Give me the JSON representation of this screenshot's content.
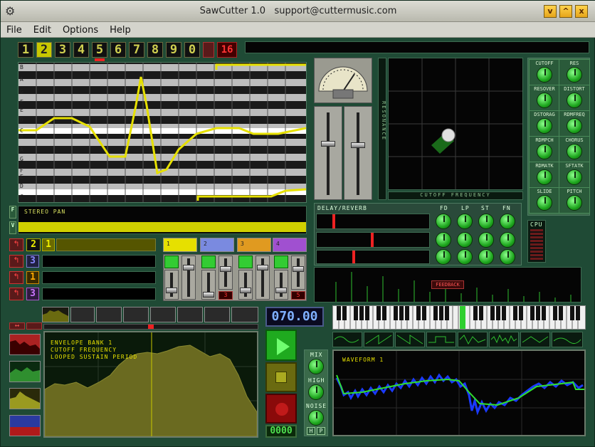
{
  "window": {
    "title": "SawCutter 1.0",
    "email": "support@cuttermusic.com"
  },
  "menu": [
    "File",
    "Edit",
    "Options",
    "Help"
  ],
  "patterns": {
    "numbers": [
      "1",
      "2",
      "3",
      "4",
      "5",
      "6",
      "7",
      "8",
      "9",
      "0"
    ],
    "selected": "2",
    "tempo_mult": "16"
  },
  "note_labels": [
    "B",
    "A",
    "G",
    "F",
    "E",
    "D",
    "C",
    "B",
    "A",
    "G",
    "F",
    "E",
    "D",
    "C"
  ],
  "rows": {
    "f": "F",
    "v": "V",
    "stereo_pan": "STEREO PAN"
  },
  "track_rows": [
    {
      "a": "2",
      "b": "1"
    },
    {
      "a": "3"
    },
    {
      "a": "1"
    },
    {
      "a": "3"
    }
  ],
  "channels": [
    {
      "label": "1",
      "color": "#e6e000",
      "mark": ""
    },
    {
      "label": "2",
      "color": "#7a8ae0",
      "mark": "3"
    },
    {
      "label": "3",
      "color": "#e09a20",
      "mark": ""
    },
    {
      "label": "4",
      "color": "#a050d0",
      "mark": "5"
    }
  ],
  "xy_pad": {
    "y_label": "RESONANCE",
    "x_label": "CUTOFF FREQUENCY"
  },
  "right_knobs": [
    "CUTOFF",
    "RES",
    "RESOVER",
    "DISTORT",
    "DSTORAG",
    "RDMFREQ",
    "RDMPCH",
    "CHORUS",
    "RDMATK",
    "SFTATK",
    "SLIDE",
    "PITCH"
  ],
  "delay": {
    "title": "DELAY/REVERB",
    "cols": [
      "FD",
      "LP",
      "ST",
      "FN"
    ],
    "feedback": "FEEDBACK"
  },
  "cpu": "CPU",
  "tempo": "070.00",
  "counter": "0000",
  "envelope": {
    "lines": [
      "ENVELOPE BANK 1",
      "CUTOFF FREQUENCY",
      "LOOPED SUSTAIN PERIOD"
    ]
  },
  "mixer": {
    "mix": "MIX",
    "high": "HIGH",
    "noise": "NOISE",
    "h": "H",
    "p": "P"
  },
  "waveform": {
    "title": "WAVEFORM 1"
  }
}
